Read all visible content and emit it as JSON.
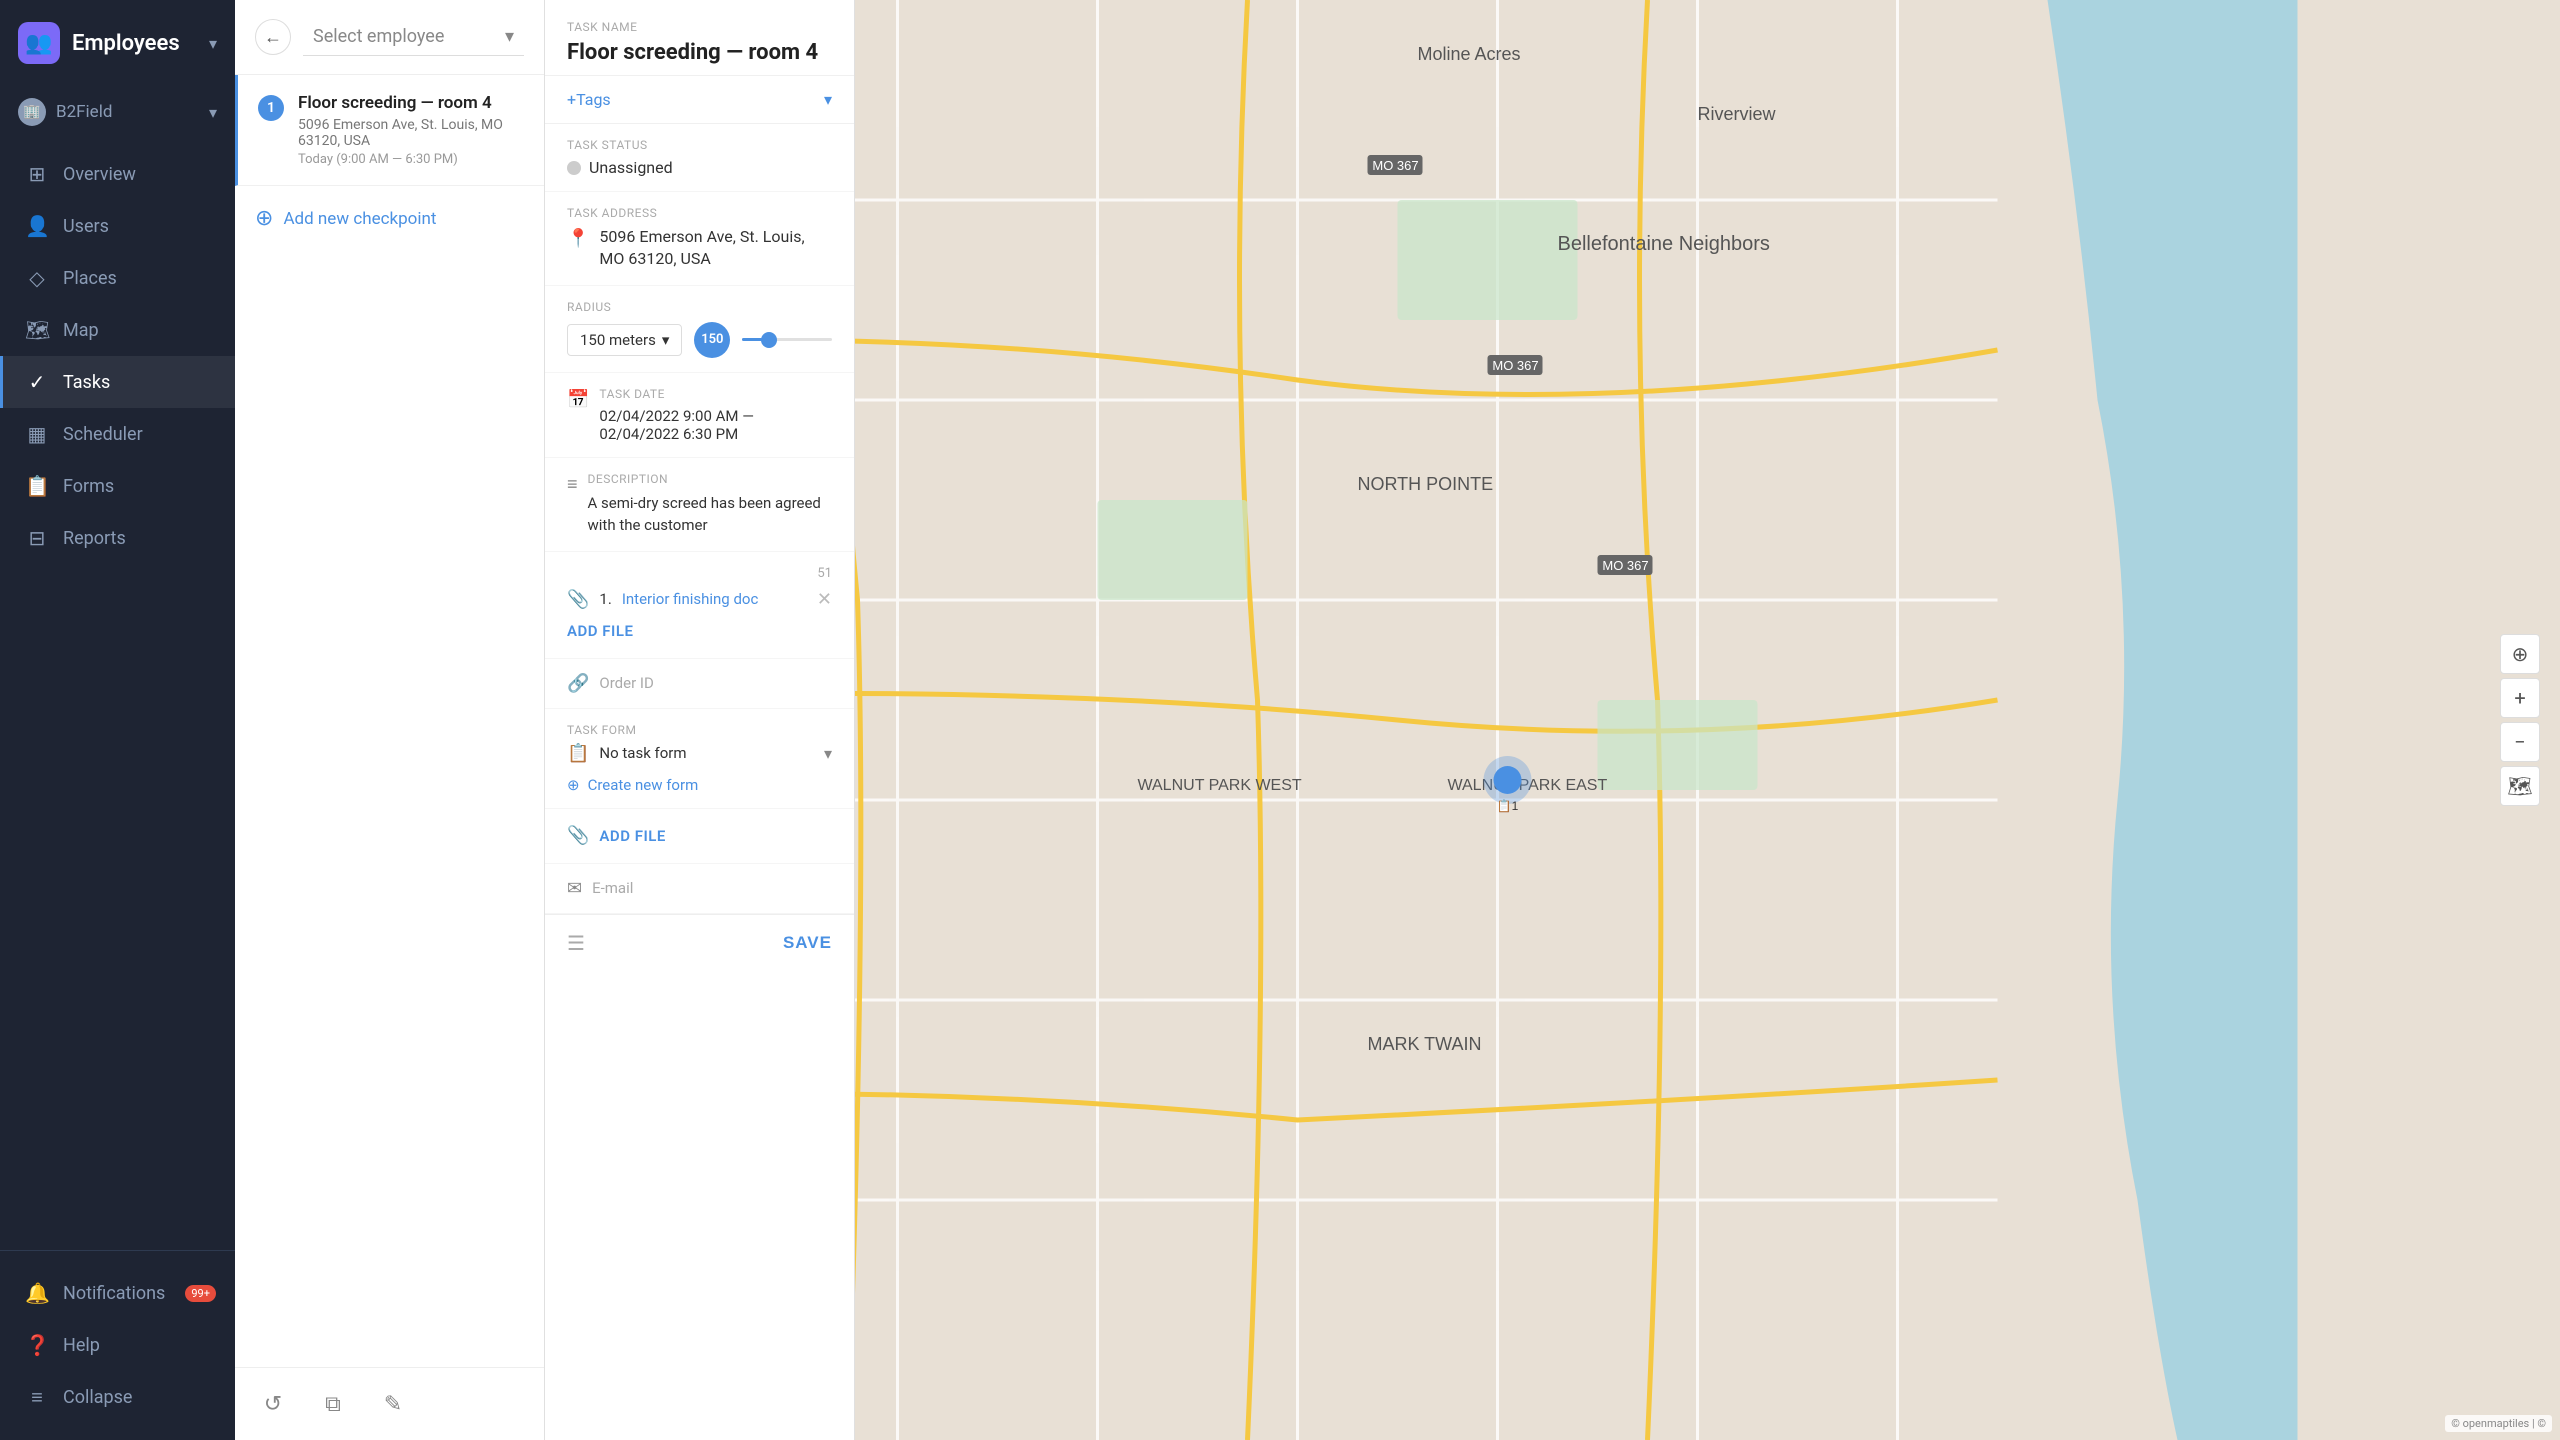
{
  "sidebar": {
    "logo": "👥",
    "title": "Employees",
    "title_arrow": "▾",
    "org": "B2Field",
    "org_arrow": "▾",
    "nav_items": [
      {
        "id": "overview",
        "icon": "⊞",
        "label": "Overview",
        "active": false
      },
      {
        "id": "users",
        "icon": "👤",
        "label": "Users",
        "active": false
      },
      {
        "id": "places",
        "icon": "◇",
        "label": "Places",
        "active": false
      },
      {
        "id": "map",
        "icon": "🗺",
        "label": "Map",
        "active": false
      },
      {
        "id": "tasks",
        "icon": "✓",
        "label": "Tasks",
        "active": true
      },
      {
        "id": "scheduler",
        "icon": "▦",
        "label": "Scheduler",
        "active": false
      },
      {
        "id": "forms",
        "icon": "📋",
        "label": "Forms",
        "active": false
      },
      {
        "id": "reports",
        "icon": "⊟",
        "label": "Reports",
        "active": false
      }
    ],
    "bottom_items": [
      {
        "id": "notifications",
        "icon": "🔔",
        "label": "Notifications",
        "badge": "99+"
      },
      {
        "id": "help",
        "icon": "?",
        "label": "Help"
      },
      {
        "id": "collapse",
        "icon": "≡",
        "label": "Collapse"
      }
    ]
  },
  "left_panel": {
    "select_employee_placeholder": "Select employee",
    "checkpoint": {
      "number": "1",
      "title": "Floor screeding — room 4",
      "address": "5096 Emerson Ave, St. Louis, MO 63120, USA",
      "time": "Today (9:00 AM — 6:30 PM)"
    },
    "add_checkpoint_label": "Add new checkpoint",
    "toolbar": {
      "refresh_icon": "↺",
      "copy_icon": "⧉",
      "edit_icon": "✎"
    }
  },
  "detail_panel": {
    "task_name_label": "Task name",
    "task_name": "Floor screeding — room 4",
    "tags_label": "+Tags",
    "task_status_label": "Task status",
    "task_status": "Unassigned",
    "task_address_label": "Task address",
    "task_address": "5096 Emerson Ave, St. Louis, MO 63120, USA",
    "radius_label": "Radius",
    "radius_value": "150 meters",
    "radius_badge": "150",
    "task_date_label": "Task date",
    "task_date": "02/04/2022 9:00 AM — 02/04/2022 6:30 PM",
    "description_label": "Description",
    "description": "A semi-dry screed has been agreed with the customer",
    "char_count": "51",
    "file_number": "1.",
    "file_name": "Interior finishing doc",
    "add_file_1": "ADD FILE",
    "order_id_label": "Order ID",
    "order_id_placeholder": "Order ID",
    "task_form_label": "Task form",
    "task_form_value": "No task form",
    "create_form_label": "Create new form",
    "add_file_2": "ADD FILE",
    "email_label": "E-mail",
    "save_button": "SAVE"
  }
}
